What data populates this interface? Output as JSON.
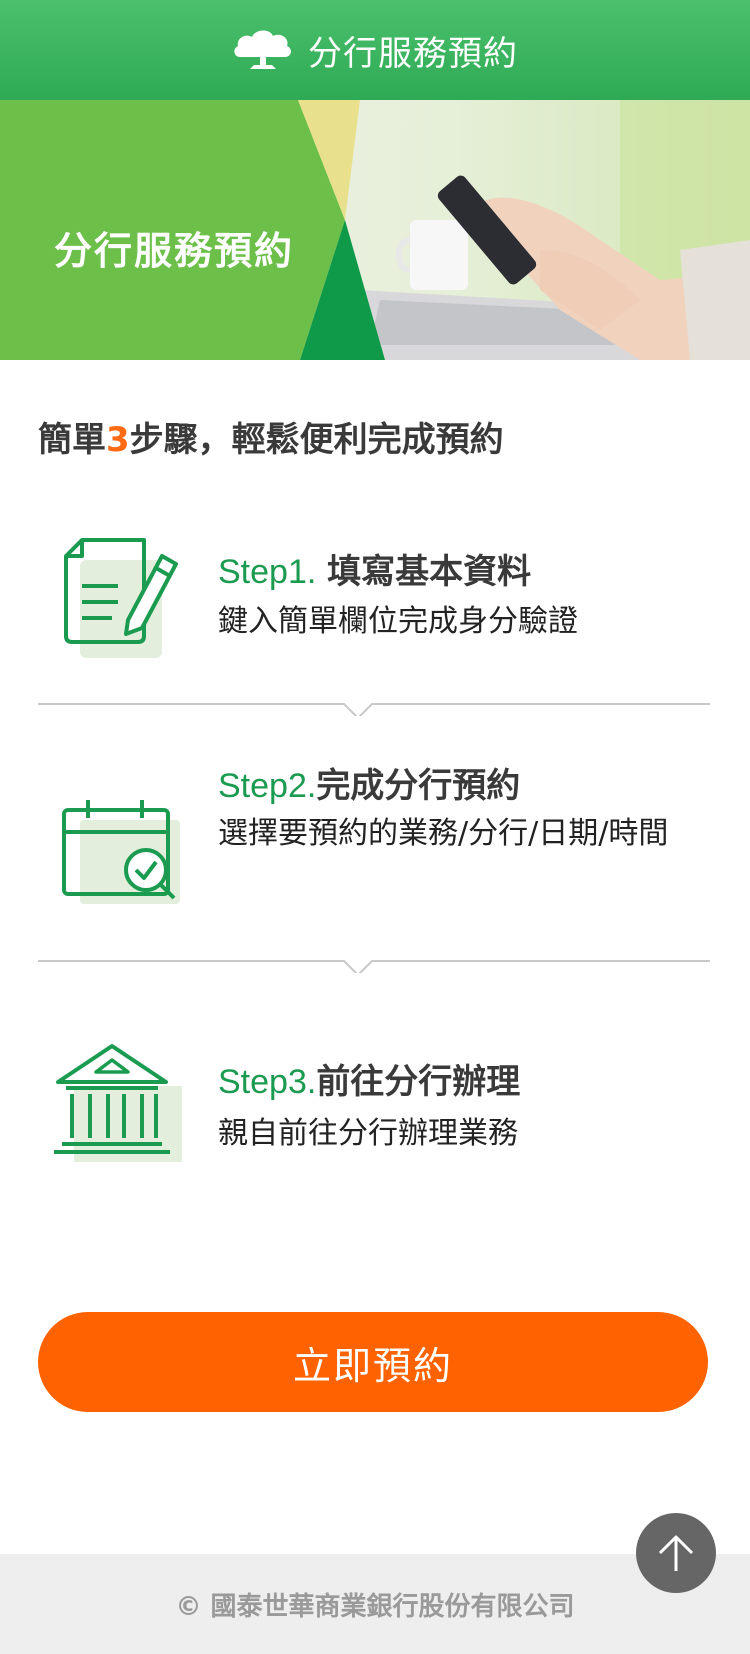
{
  "header": {
    "title": "分行服務預約",
    "logo_icon": "tree-logo-icon"
  },
  "banner": {
    "title": "分行服務預約"
  },
  "intro": {
    "prefix": "簡單",
    "number": "3",
    "suffix": "步驟，輕鬆便利完成預約"
  },
  "steps": [
    {
      "no": "Step1.",
      "title": "填寫基本資料",
      "desc": "鍵入簡單欄位完成身分驗證",
      "icon": "document-edit-icon"
    },
    {
      "no": "Step2.",
      "title": "完成分行預約",
      "desc": "選擇要預約的業務/分行/日期/時間",
      "icon": "calendar-search-icon"
    },
    {
      "no": "Step3.",
      "title": "前往分行辦理",
      "desc": "親自前往分行辦理業務",
      "icon": "bank-building-icon"
    }
  ],
  "cta": {
    "label": "立即預約"
  },
  "footer": {
    "copyright": "© 國泰世華商業銀行股份有限公司"
  },
  "back_to_top": {
    "icon": "arrow-up-icon"
  },
  "colors": {
    "brand_green": "#2eaa55",
    "accent_orange": "#ff6200",
    "step_green": "#1a9b50"
  }
}
